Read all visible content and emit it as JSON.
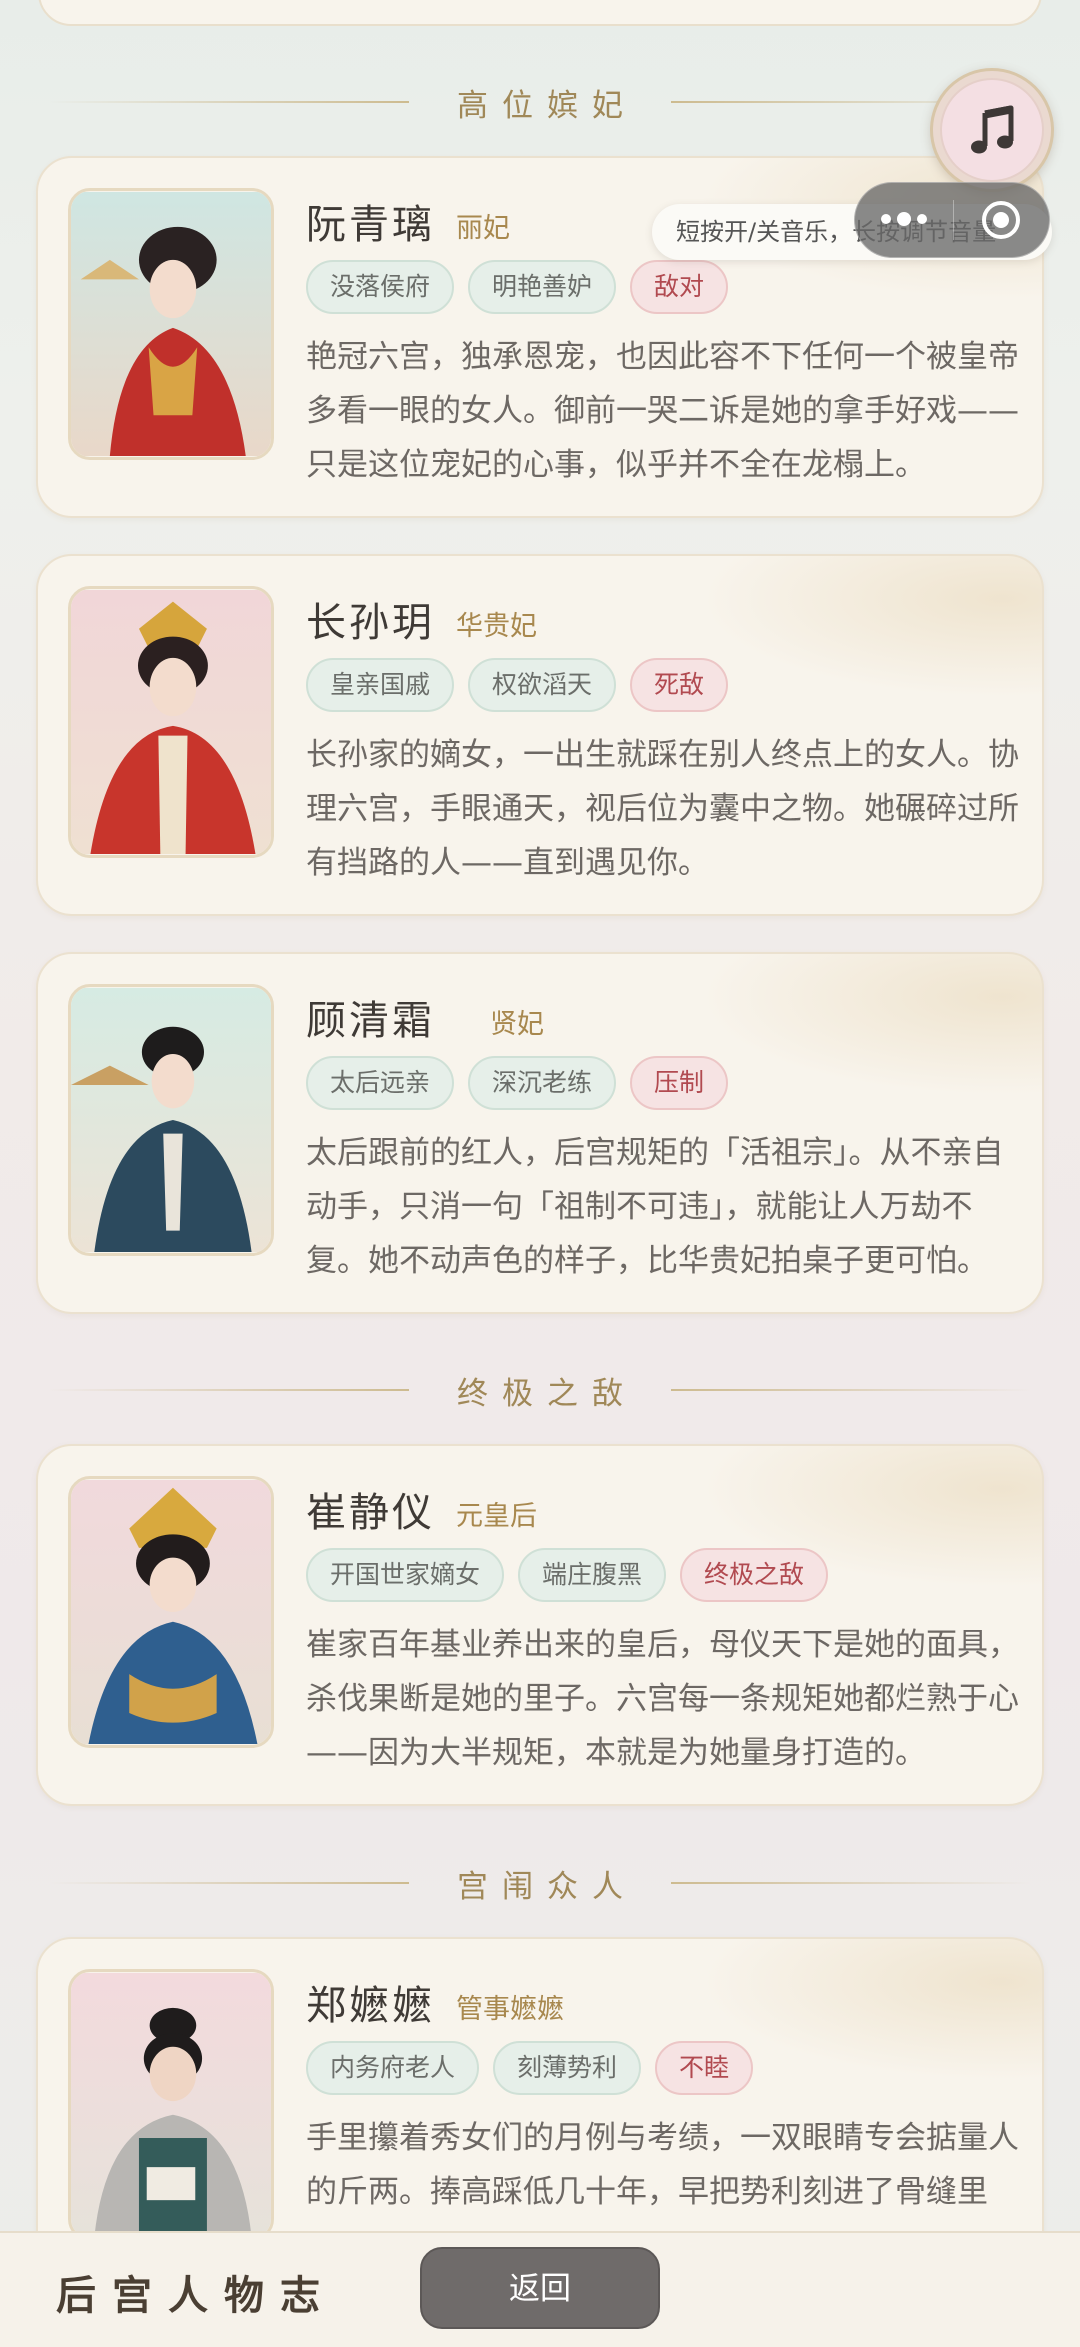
{
  "sections": {
    "high": "高位嫔妃",
    "ultimate": "终极之敌",
    "palace": "宫闱众人"
  },
  "music": {
    "tooltip": "短按开/关音乐，长按调节音量"
  },
  "characters": [
    {
      "name": "阮青璃",
      "rank": "丽妃",
      "tags": [
        "没落侯府",
        "明艳善妒"
      ],
      "relation": "敌对",
      "desc": "艳冠六宫，独承恩宠，也因此容不下任何一个被皇帝多看一眼的女人。御前一哭二诉是她的拿手好戏——只是这位宠妃的心事，似乎并不全在龙榻上。"
    },
    {
      "name": "长孙玥",
      "rank": "华贵妃",
      "tags": [
        "皇亲国戚",
        "权欲滔天"
      ],
      "relation": "死敌",
      "desc": "长孙家的嫡女，一出生就踩在别人终点上的女人。协理六宫，手眼通天，视后位为囊中之物。她碾碎过所有挡路的人——直到遇见你。"
    },
    {
      "name": "顾清霜",
      "rank": "贤妃",
      "tags": [
        "太后远亲",
        "深沉老练"
      ],
      "relation": "压制",
      "desc": "太后跟前的红人，后宫规矩的「活祖宗」。从不亲自动手，只消一句「祖制不可违」，就能让人万劫不复。她不动声色的样子，比华贵妃拍桌子更可怕。"
    },
    {
      "name": "崔静仪",
      "rank": "元皇后",
      "tags": [
        "开国世家嫡女",
        "端庄腹黑"
      ],
      "relation": "终极之敌",
      "desc": "崔家百年基业养出来的皇后，母仪天下是她的面具，杀伐果断是她的里子。六宫每一条规矩她都烂熟于心——因为大半规矩，本就是为她量身打造的。"
    },
    {
      "name": "郑嬷嬷",
      "rank": "管事嬷嬷",
      "tags": [
        "内务府老人",
        "刻薄势利"
      ],
      "relation": "不睦",
      "desc": "手里攥着秀女们的月例与考绩，一双眼睛专会掂量人的斤两。捧高踩低几十年，早把势利刻进了骨缝里"
    }
  ],
  "bottom": {
    "title": "后宫人物志",
    "back": "返回"
  },
  "colors": {
    "card_bg": "#f8f4ec",
    "tag_green": "#e6efe9",
    "tag_red": "#f6e3e3",
    "accent_gold": "#a8884e"
  }
}
